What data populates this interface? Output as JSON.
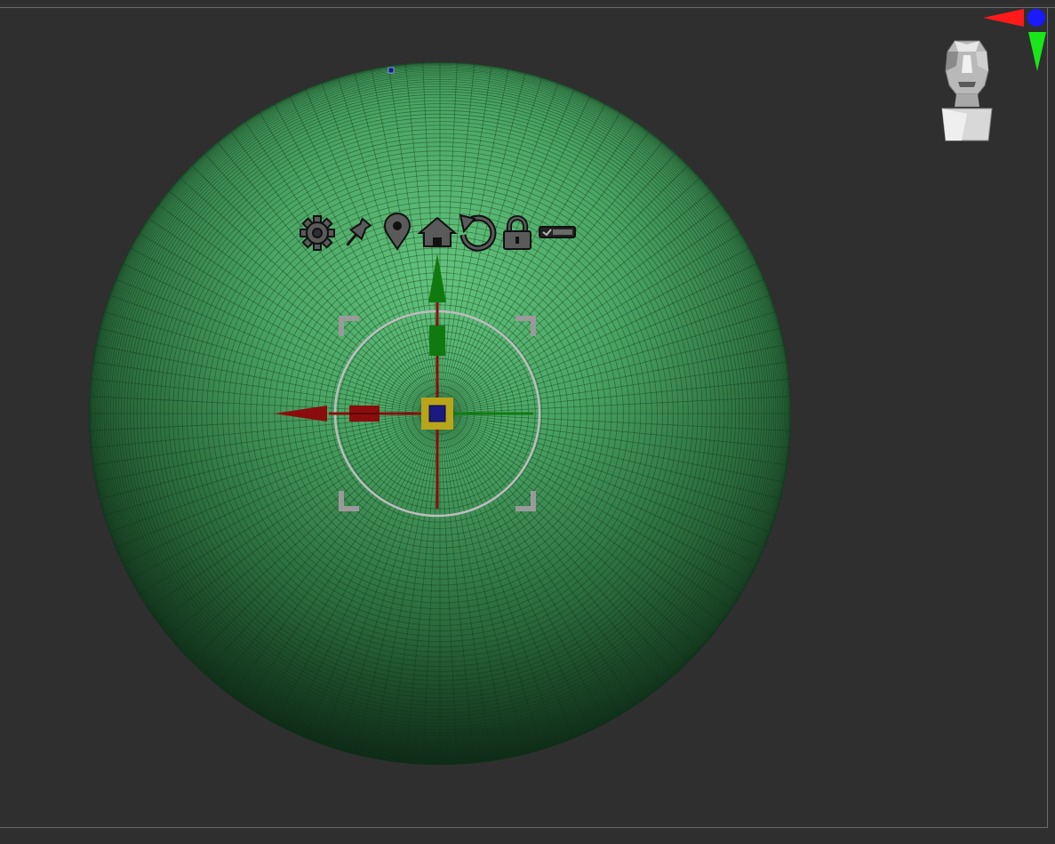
{
  "viewport": {
    "background": "#2f2f2f",
    "frame_color": "#6a6a6a"
  },
  "mesh": {
    "type": "sphere",
    "color": "#4fb26a",
    "shadow_color": "#0b2412",
    "wire_color": "#103018"
  },
  "gizmo": {
    "toolbar_icons": [
      "gear-icon",
      "pin-icon",
      "location-pin-icon",
      "home-icon",
      "reset-rotation-icon",
      "lock-icon",
      "toggle-icon"
    ],
    "axis_x_color": "#8b0c0c",
    "axis_y_color": "#107a10",
    "axis_z_color": "#1a1a80",
    "center_color": "#b9a51a",
    "ring_color": "#b8b8b8"
  },
  "nav_cube": {
    "icons": [
      "head-navigation-icon",
      "x-axis-arrow-icon",
      "y-axis-arrow-icon",
      "z-axis-dot-icon"
    ],
    "x_color": "#ff1a1a",
    "y_color": "#19e619",
    "z_color": "#1a1aff"
  }
}
